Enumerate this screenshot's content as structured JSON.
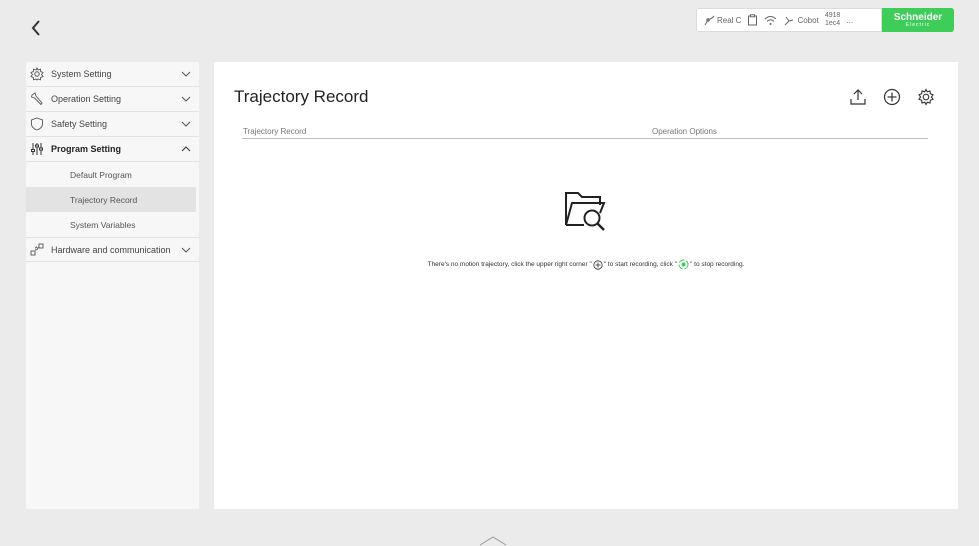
{
  "status": {
    "mode_label": "Real C",
    "robot_label": "Cobot",
    "counter_top": "4918",
    "counter_bottom": "1ec4",
    "more": "...",
    "brand_name": "Schneider",
    "brand_sub": "Electric"
  },
  "sidebar": {
    "system_setting": "System Setting",
    "operation_setting": "Operation Setting",
    "safety_setting": "Safety Setting",
    "program_setting": "Program Setting",
    "sub": {
      "default_program": "Default Program",
      "trajectory_record": "Trajectory Record",
      "system_variables": "System Variables"
    },
    "hardware_comm": "Hardware and communication"
  },
  "main": {
    "title": "Trajectory Record",
    "columns": [
      "Trajectory Record",
      "Operation Options"
    ],
    "empty_msg_1": "There's no motion trajectory, click the upper right corner \"",
    "empty_msg_2": "\" to start recording, click \"",
    "empty_msg_3": "\" to stop recording."
  },
  "colors": {
    "brand": "#3dcd58",
    "accent": "#3dcd58"
  }
}
